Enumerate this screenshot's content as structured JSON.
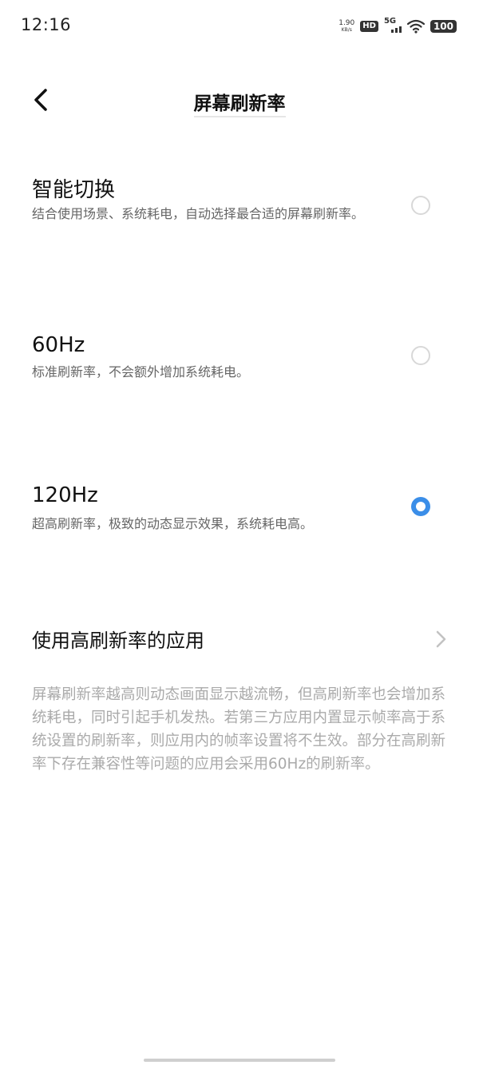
{
  "status_bar": {
    "time": "12:16",
    "net_speed_value": "1.90",
    "net_speed_unit": "KB/s",
    "hd_label": "HD",
    "network_label": "5G",
    "battery_level": "100"
  },
  "header": {
    "title": "屏幕刷新率"
  },
  "options": [
    {
      "title": "智能切换",
      "description": "结合使用场景、系统耗电，自动选择最合适的屏幕刷新率。",
      "selected": false
    },
    {
      "title": "60Hz",
      "description": "标准刷新率，不会额外增加系统耗电。",
      "selected": false
    },
    {
      "title": "120Hz",
      "description": "超高刷新率，极致的动态显示效果，系统耗电高。",
      "selected": true
    }
  ],
  "apps_entry": {
    "label": "使用高刷新率的应用"
  },
  "footnote": "屏幕刷新率越高则动态画面显示越流畅，但高刷新率也会增加系统耗电，同时引起手机发热。若第三方应用内置显示帧率高于系统设置的刷新率，则应用内的帧率设置将不生效。部分在高刷新率下存在兼容性等问题的应用会采用60Hz的刷新率。",
  "colors": {
    "accent": "#3b8ee8",
    "secondary_text": "#666666",
    "footnote_text": "#aaaaaa"
  }
}
